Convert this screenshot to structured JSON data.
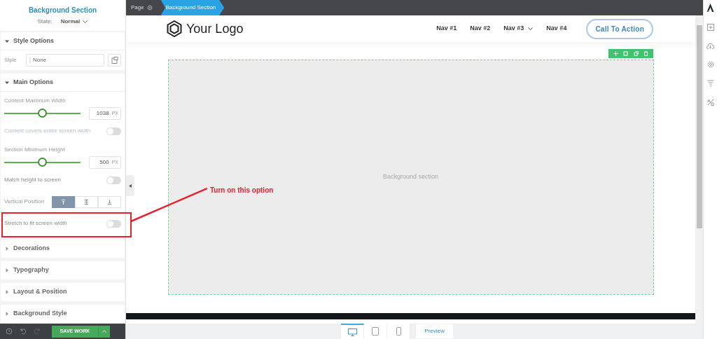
{
  "panel": {
    "title": "Background Section",
    "state_label": "State:",
    "state_value": "Normal"
  },
  "style_options": {
    "title": "Style Options",
    "expanded": true,
    "style_label": "Style",
    "style_value": "None"
  },
  "main_options": {
    "title": "Main Options",
    "expanded": true,
    "rows": [
      {
        "kind": "slider",
        "label": "Content Maximum Width",
        "level": 0.49,
        "value": "1038",
        "unit": "PX"
      },
      {
        "kind": "toggle",
        "label": "Content covers entire screen width",
        "on": false,
        "disabled": true
      },
      {
        "kind": "slider",
        "label": "Section Minimum Height",
        "level": 0.49,
        "value": "500",
        "unit": "PX"
      },
      {
        "kind": "toggle",
        "label": "Match height to screen",
        "on": false,
        "disabled": false
      },
      {
        "kind": "segments",
        "label": "Vertical Position",
        "options": [
          {
            "selected": true
          },
          {
            "selected": false
          },
          {
            "selected": false
          }
        ]
      },
      {
        "kind": "toggle",
        "label": "Stretch to fit screen width",
        "on": false,
        "disabled": false
      }
    ]
  },
  "collapsed_sections": [
    {
      "title": "Decorations",
      "expanded": false
    },
    {
      "title": "Typography",
      "expanded": false
    },
    {
      "title": "Layout & Position",
      "expanded": false
    },
    {
      "title": "Background Style",
      "expanded": false
    }
  ],
  "footer": {
    "save": "SAVE WORK"
  },
  "breadcrumb": [
    {
      "label": "Page",
      "selected": false
    },
    {
      "label": "Background Section",
      "selected": true
    }
  ],
  "site": {
    "logo": "Your Logo",
    "nav": [
      {
        "label": "Nav #1",
        "has_menu": false
      },
      {
        "label": "Nav #2",
        "has_menu": false
      },
      {
        "label": "Nav #3",
        "has_menu": true
      },
      {
        "label": "Nav #4",
        "has_menu": false
      }
    ],
    "cta": "Call To Action",
    "section_label": "Background section"
  },
  "devices": [
    {
      "kind": "desktop",
      "selected": true
    },
    {
      "kind": "tablet",
      "selected": false
    },
    {
      "kind": "phone",
      "selected": false
    }
  ],
  "preview": "Preview",
  "annotation": {
    "text": "Turn on this option"
  }
}
